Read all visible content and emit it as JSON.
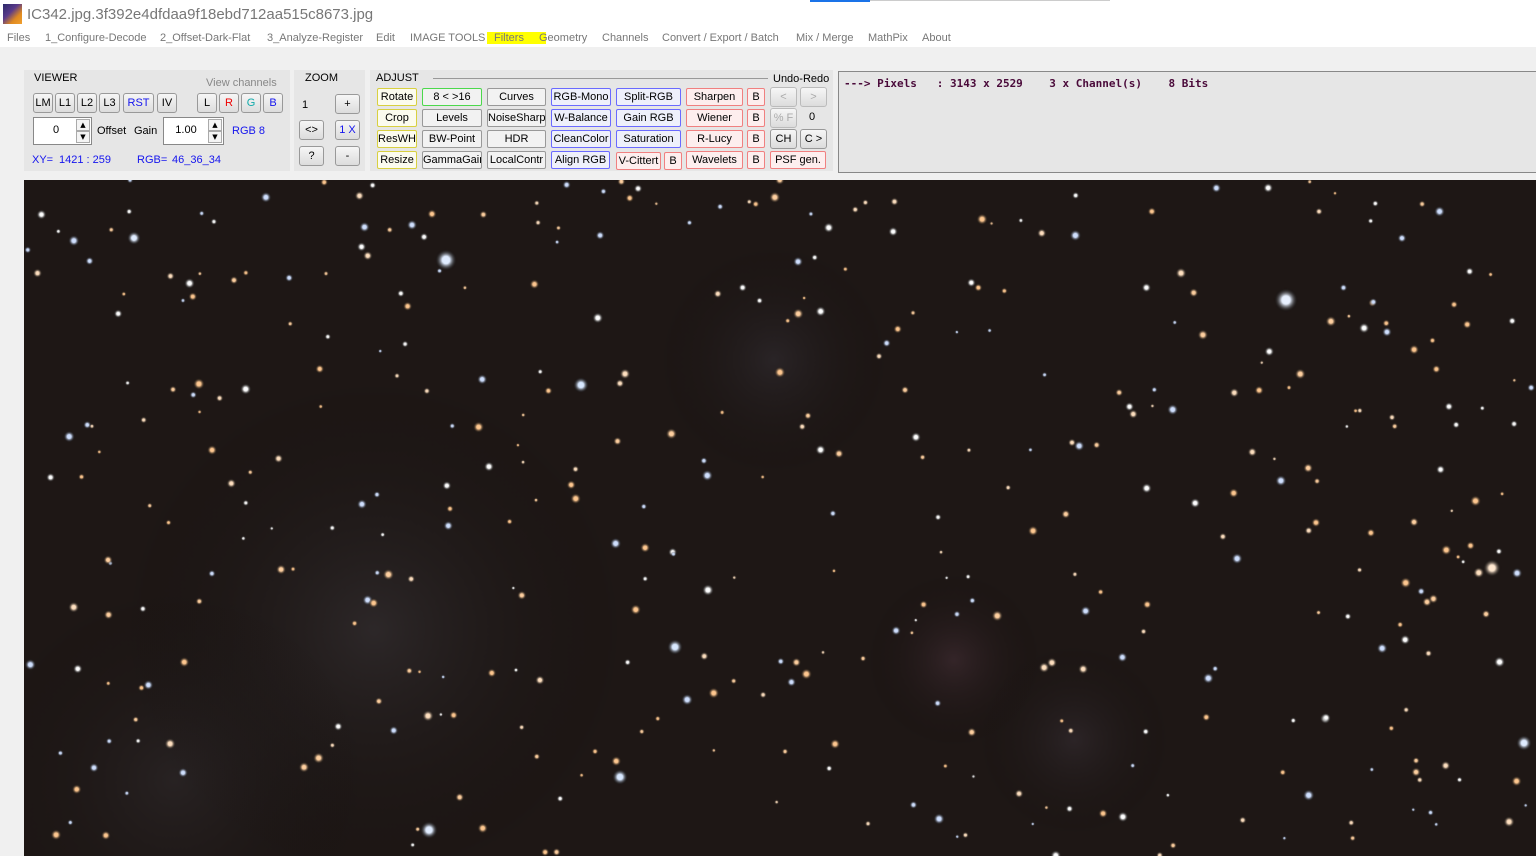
{
  "window": {
    "title": "IC342.jpg.3f392e4dfdaa9f18ebd712aa515c8673.jpg"
  },
  "menu": [
    "Files",
    "1_Configure-Decode",
    "2_Offset-Dark-Flat",
    "3_Analyze-Register",
    "Edit",
    "IMAGE TOOLS",
    "Filters",
    "Geometry",
    "Channels",
    "Convert / Export / Batch",
    "Mix / Merge",
    "MathPix",
    "About"
  ],
  "viewer": {
    "title": "VIEWER",
    "view_channels_label": "View channels",
    "buttons": [
      "LM",
      "L1",
      "L2",
      "L3",
      "RST",
      "IV"
    ],
    "channels": [
      "L",
      "R",
      "G",
      "B"
    ],
    "offset_value": "0",
    "offset_label": "Offset",
    "gain_label": "Gain",
    "gain_value": "1.00",
    "rgb_mode": "RGB 8",
    "xy_label": "XY=",
    "xy_value": "1421 : 259",
    "rgb_label": "RGB=",
    "rgb_value": "46_36_34"
  },
  "zoom": {
    "title": "ZOOM",
    "level": "1",
    "plus": "+",
    "fit": "<>",
    "one_x": "1 X",
    "help": "?",
    "minus": "-"
  },
  "adjust": {
    "title": "ADJUST",
    "undo_redo_label": "Undo-Redo",
    "col1": [
      "Rotate",
      "Crop",
      "ResWH",
      "Resize"
    ],
    "col2": [
      "8 < >16",
      "Levels",
      "BW-Point",
      "GammaGain"
    ],
    "col3": [
      "Curves",
      "NoiseSharp",
      "HDR",
      "LocalContr"
    ],
    "col4": [
      "RGB-Mono",
      "W-Balance",
      "CleanColor",
      "Align RGB"
    ],
    "col5": [
      "Split-RGB",
      "Gain RGB",
      "Saturation"
    ],
    "vcittert": "V-Cittert",
    "b": "B",
    "col6": [
      "Sharpen",
      "Wiener",
      "R-Lucy",
      "Wavelets"
    ],
    "undo": "<",
    "redo": ">",
    "percent_f": "% F",
    "undo_count": "0",
    "ch": "CH",
    "c_next": "C >",
    "psf": "PSF gen."
  },
  "info": {
    "text": "---> Pixels   : 3143 x 2529    3 x Channel(s)    8 Bits"
  },
  "colors": {
    "yellow_highlight": "#ffff00",
    "info_text": "#4a0a3a",
    "blue_text": "#1515ee",
    "sky": "#1e1715"
  }
}
